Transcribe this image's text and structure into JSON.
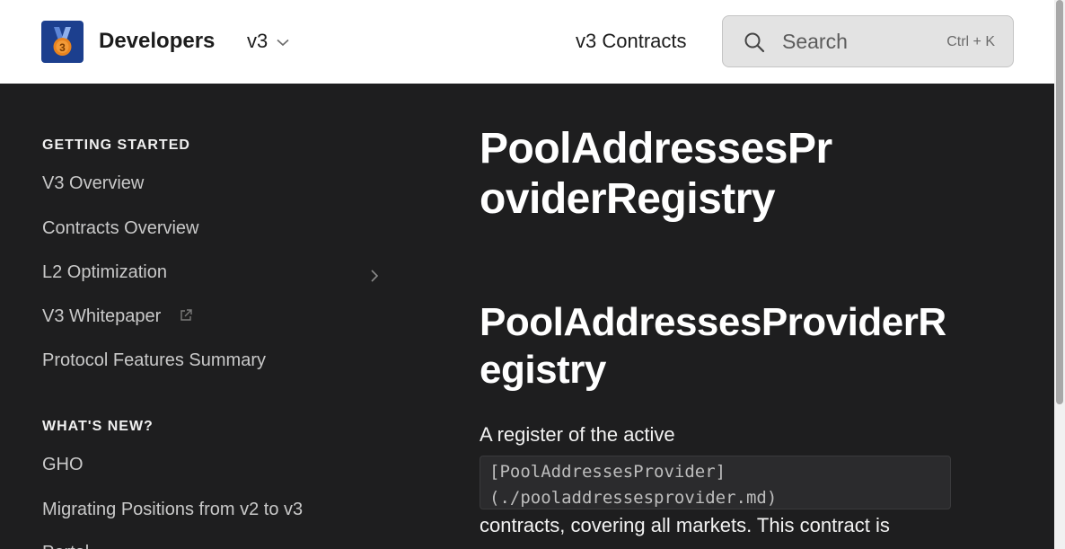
{
  "header": {
    "brand": "Developers",
    "version": "v3",
    "nav_link": "v3 Contracts",
    "search": {
      "label": "Search",
      "shortcut": "Ctrl + K"
    },
    "colors": {
      "logo_bg": "#1c3f8e",
      "medal": "#e8831e"
    }
  },
  "sidebar": {
    "sections": [
      {
        "title": "GETTING STARTED",
        "items": [
          {
            "label": "V3 Overview"
          },
          {
            "label": "Contracts Overview"
          },
          {
            "label": "L2 Optimization",
            "icon": "chevron-right-icon"
          },
          {
            "label": "V3 Whitepaper",
            "icon": "external-link-icon"
          },
          {
            "label": "Protocol Features Summary"
          }
        ]
      },
      {
        "title": "WHAT'S NEW?",
        "items": [
          {
            "label": "GHO"
          },
          {
            "label": "Migrating Positions from v2 to v3"
          },
          {
            "label": "Portal"
          }
        ]
      }
    ]
  },
  "main": {
    "h1": "PoolAddressesProviderRegistry",
    "h2": "PoolAddressesProviderRegistry",
    "intro": "A register of the active",
    "code_lines": [
      "[PoolAddressesProvider]",
      "(./pooladdressesprovider.md)"
    ],
    "continued": "contracts, covering all markets. This contract is"
  }
}
